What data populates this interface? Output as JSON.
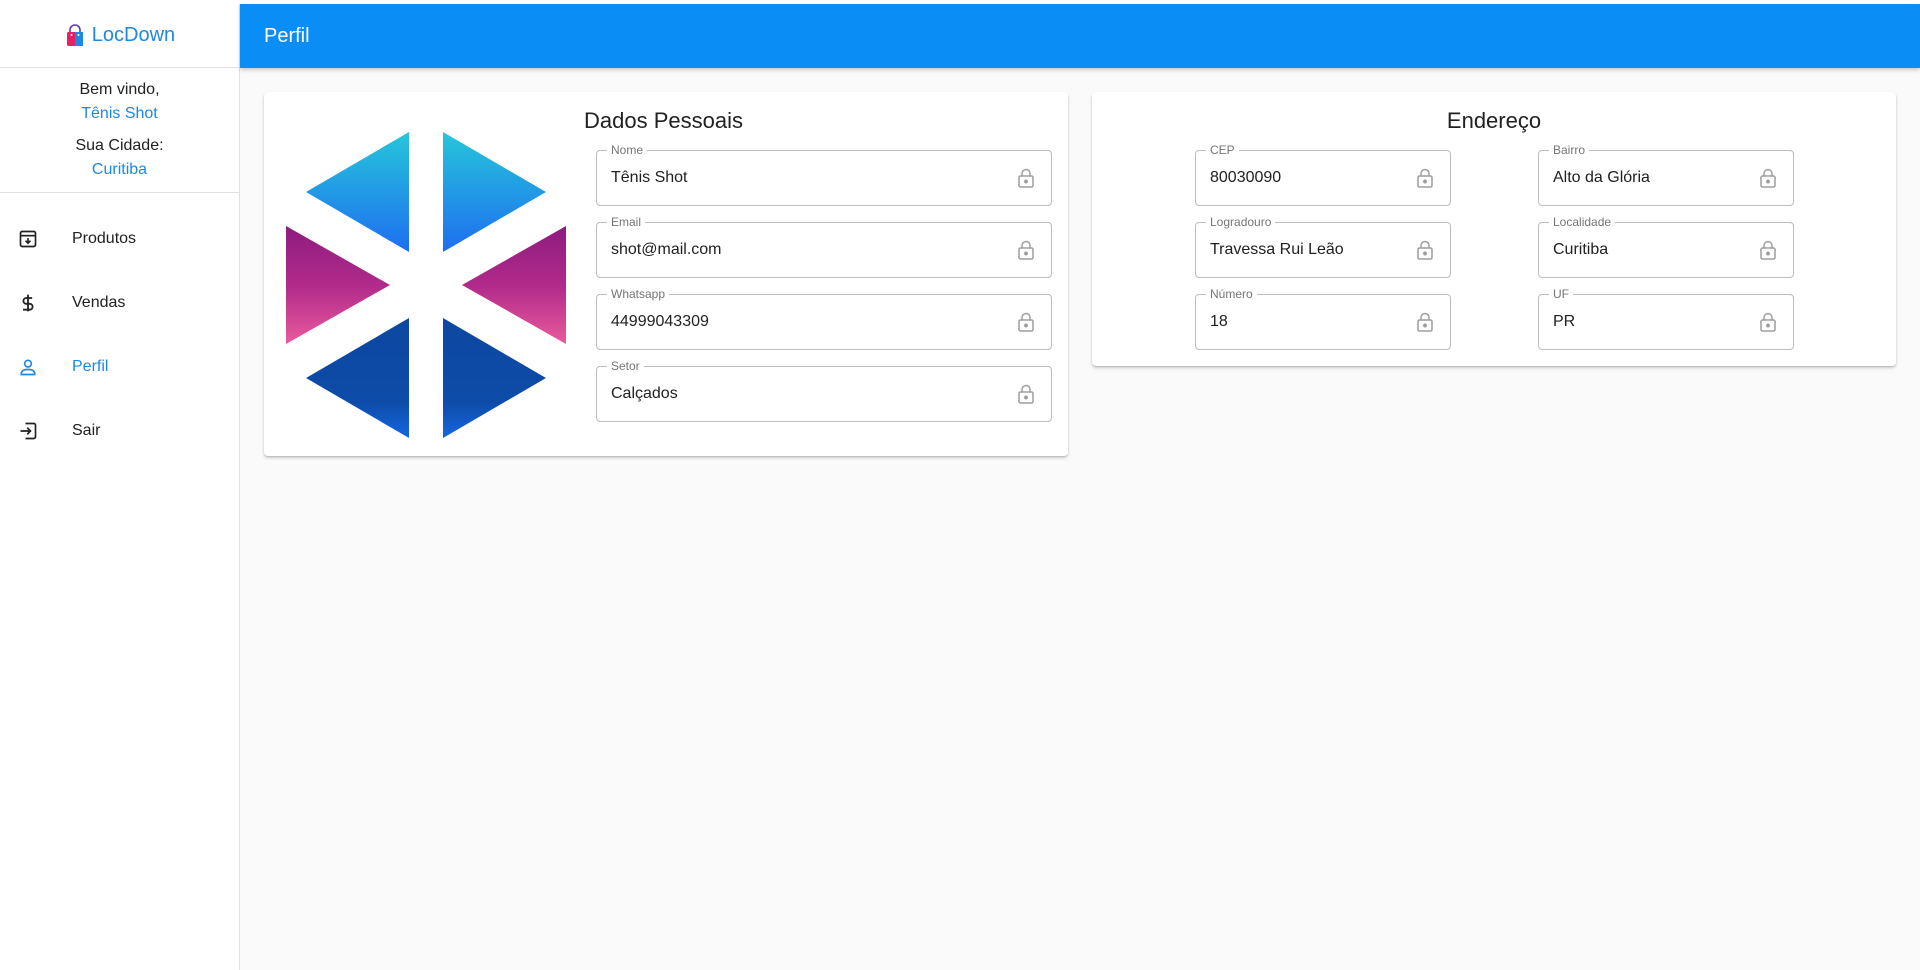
{
  "brand": {
    "name": "LocDown",
    "icon": "shopping-bag-icon"
  },
  "welcome": {
    "greeting_label": "Bem vindo,",
    "user_name": "Tênis Shot",
    "city_label": "Sua Cidade:",
    "city": "Curitiba"
  },
  "nav": {
    "items": [
      {
        "label": "Produtos",
        "icon": "archive-icon",
        "active": false
      },
      {
        "label": "Vendas",
        "icon": "dollar-icon",
        "active": false
      },
      {
        "label": "Perfil",
        "icon": "person-icon",
        "active": true
      },
      {
        "label": "Sair",
        "icon": "logout-icon",
        "active": false
      }
    ]
  },
  "appbar": {
    "title": "Perfil"
  },
  "personal": {
    "title": "Dados Pessoais",
    "fields": [
      {
        "label": "Nome",
        "value": "Tênis Shot"
      },
      {
        "label": "Email",
        "value": "shot@mail.com"
      },
      {
        "label": "Whatsapp",
        "value": "44999043309"
      },
      {
        "label": "Setor",
        "value": "Calçados"
      }
    ]
  },
  "address": {
    "title": "Endereço",
    "fields": [
      {
        "label": "CEP",
        "value": "80030090"
      },
      {
        "label": "Bairro",
        "value": "Alto da Glória"
      },
      {
        "label": "Logradouro",
        "value": "Travessa Rui Leão"
      },
      {
        "label": "Localidade",
        "value": "Curitiba"
      },
      {
        "label": "Número",
        "value": "18"
      },
      {
        "label": "UF",
        "value": "PR"
      }
    ]
  },
  "colors": {
    "primary": "#0a8ef6",
    "accent_text": "#1e88e5",
    "field_border": "#bdbdbd"
  }
}
